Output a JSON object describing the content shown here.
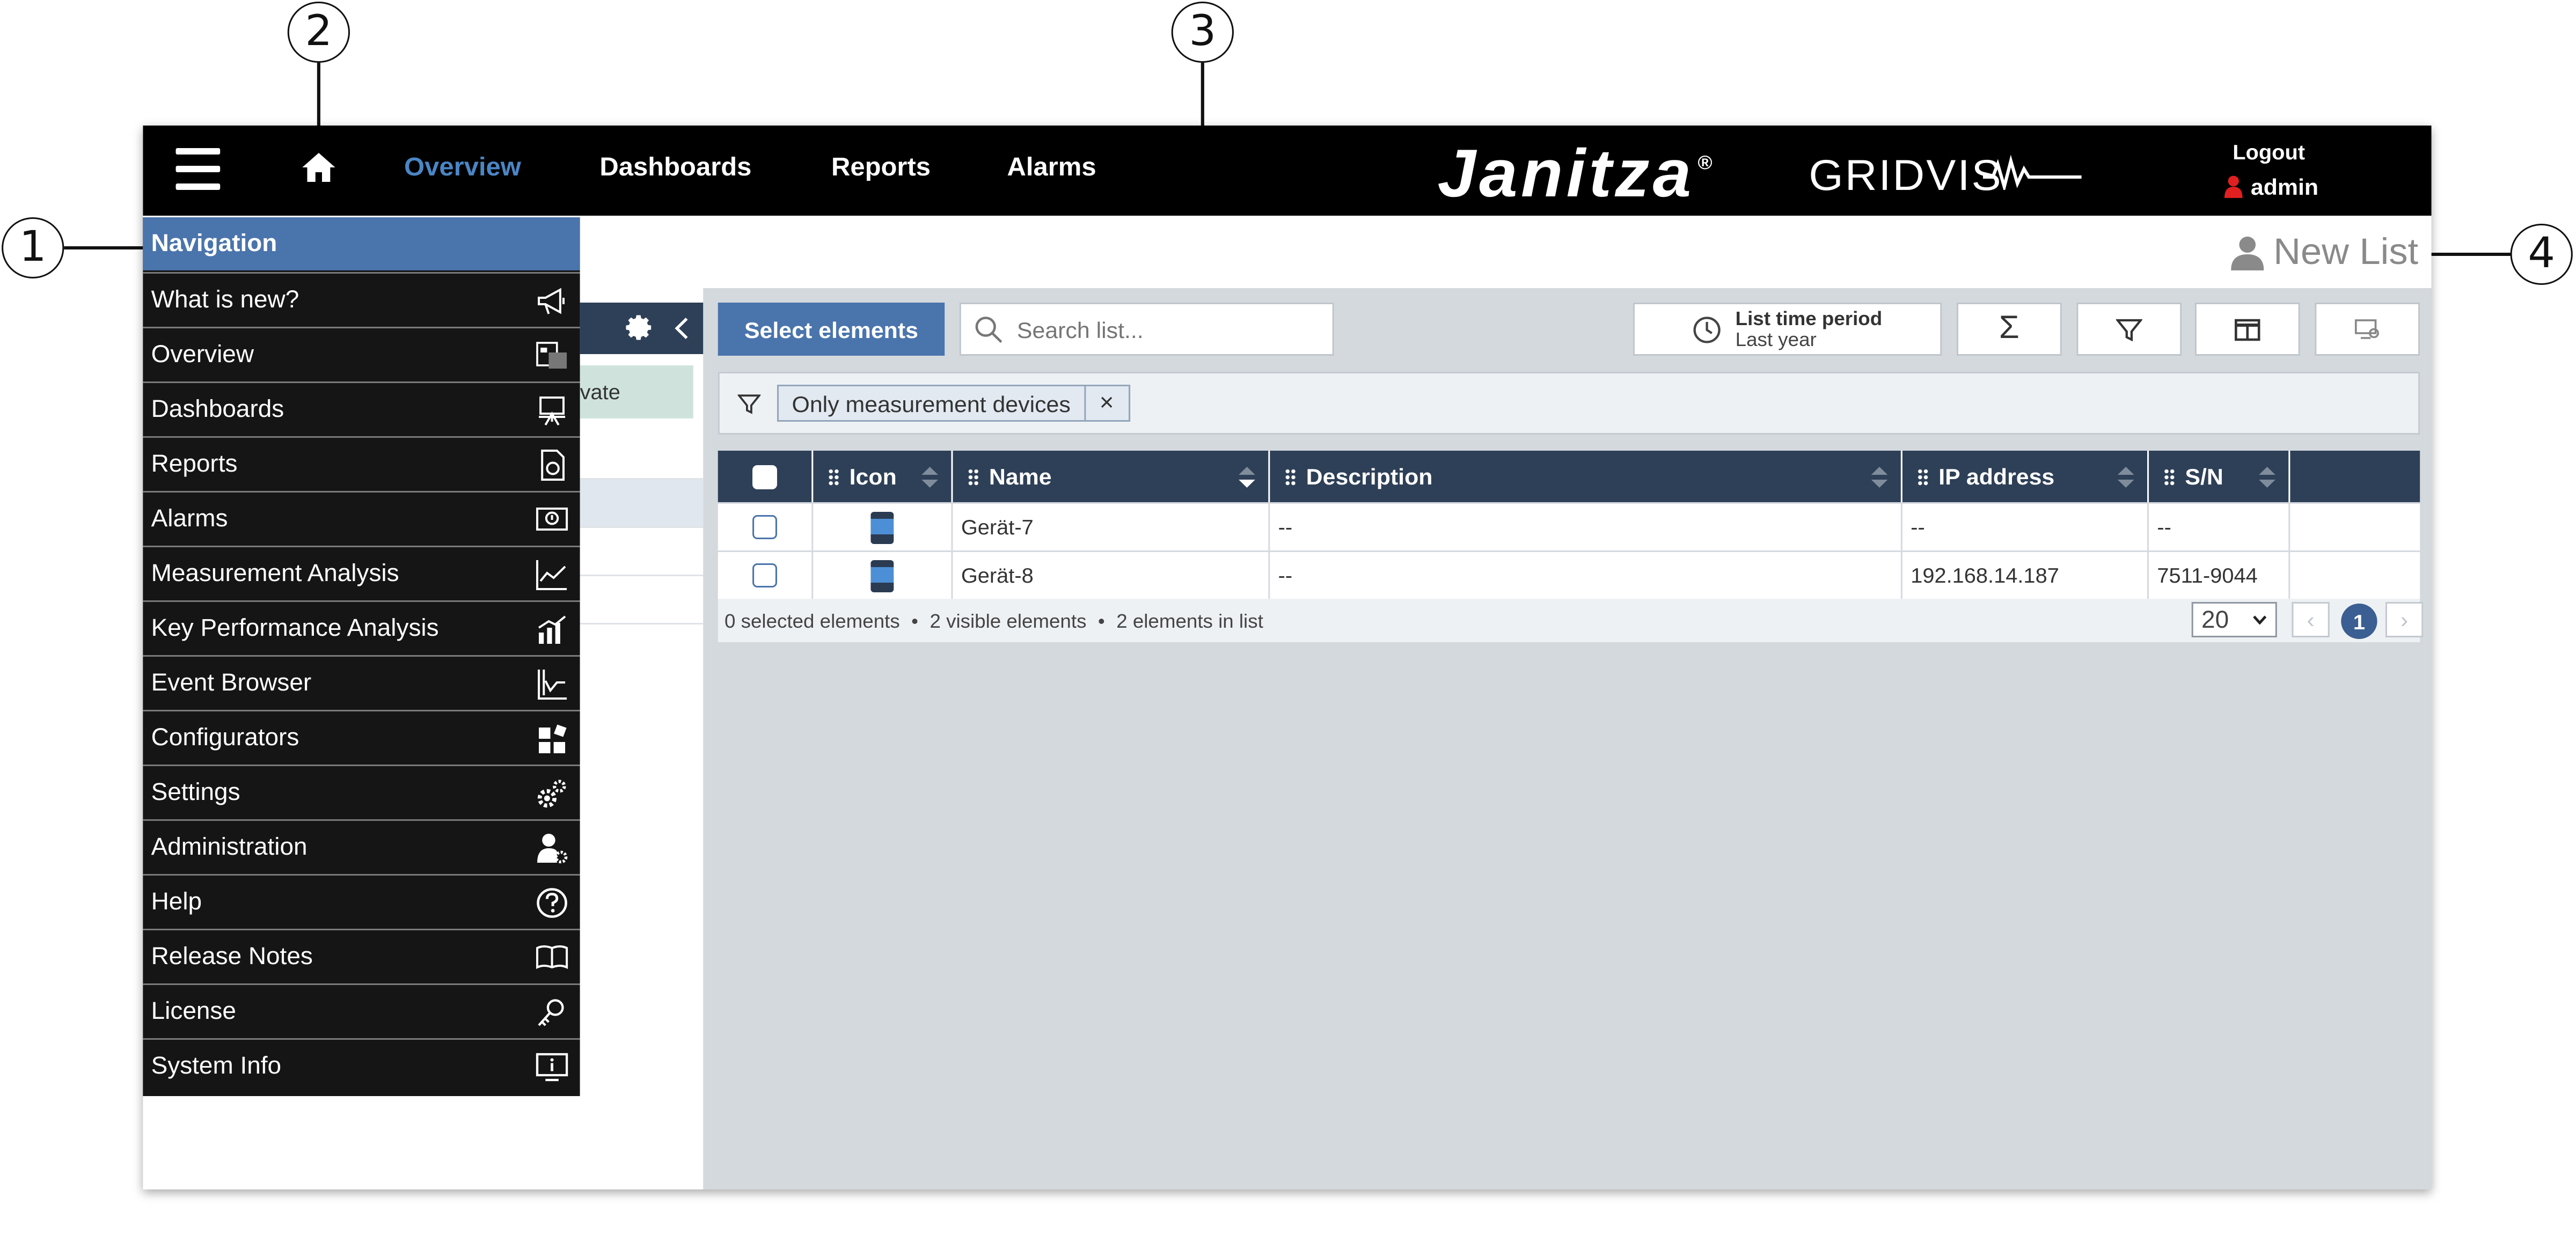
{
  "callouts": [
    "1",
    "2",
    "3",
    "4"
  ],
  "topbar": {
    "nav": [
      "Overview",
      "Dashboards",
      "Reports",
      "Alarms"
    ],
    "active": "Overview",
    "brand": "Janitza",
    "brand_mark": "®",
    "product": "GRIDVIS",
    "logout": "Logout",
    "user": "admin"
  },
  "subheader": {
    "title": "New List"
  },
  "left_panel": {
    "private_label": "vate"
  },
  "toolbar": {
    "select_elements": "Select elements",
    "search_placeholder": "Search list...",
    "time_period_label": "List time period",
    "time_period_value": "Last year",
    "sum_symbol": "Σ"
  },
  "filter": {
    "chip": "Only measurement devices",
    "remove": "×"
  },
  "table": {
    "columns": [
      "Icon",
      "Name",
      "Description",
      "IP address",
      "S/N"
    ],
    "rows": [
      {
        "name": "Gerät-7",
        "description": "--",
        "ip": "--",
        "sn": "--"
      },
      {
        "name": "Gerät-8",
        "description": "--",
        "ip": "192.168.14.187",
        "sn": "7511-9044"
      }
    ]
  },
  "status": {
    "selected": "0 selected elements",
    "visible": "2 visible elements",
    "in_list": "2 elements in list",
    "sep": "•",
    "page_size": "20",
    "page": "1",
    "prev": "‹",
    "next": "›"
  },
  "navigation": {
    "title": "Navigation",
    "items": [
      {
        "label": "What is new?",
        "icon": "megaphone-icon"
      },
      {
        "label": "Overview",
        "icon": "overview-icon"
      },
      {
        "label": "Dashboards",
        "icon": "easel-icon"
      },
      {
        "label": "Reports",
        "icon": "report-icon"
      },
      {
        "label": "Alarms",
        "icon": "alarm-icon"
      },
      {
        "label": "Measurement Analysis",
        "icon": "line-chart-icon"
      },
      {
        "label": "Key Performance Analysis",
        "icon": "bar-chart-icon"
      },
      {
        "label": "Event Browser",
        "icon": "event-chart-icon"
      },
      {
        "label": "Configurators",
        "icon": "configurator-icon"
      },
      {
        "label": "Settings",
        "icon": "gears-icon"
      },
      {
        "label": "Administration",
        "icon": "admin-user-icon"
      },
      {
        "label": "Help",
        "icon": "help-icon"
      },
      {
        "label": "Release Notes",
        "icon": "book-icon"
      },
      {
        "label": "License",
        "icon": "key-icon"
      },
      {
        "label": "System Info",
        "icon": "monitor-info-icon"
      }
    ]
  },
  "colors": {
    "accent": "#4a74ac",
    "topbar": "#000000",
    "table_header": "#2e4057",
    "active_nav": "#4a86c5"
  }
}
